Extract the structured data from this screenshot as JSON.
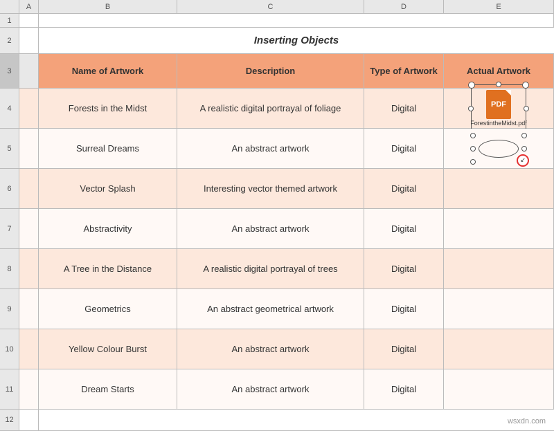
{
  "title": "Inserting Objects",
  "colHeaders": [
    "",
    "A",
    "B",
    "C",
    "D",
    "E"
  ],
  "tableHeaders": {
    "name": "Name of Artwork",
    "description": "Description",
    "type": "Type of Artwork",
    "actual": "Actual Artwork"
  },
  "rows": [
    {
      "rowNum": "4",
      "name": "Forests in the Midst",
      "description": "A realistic digital portrayal of  foliage",
      "type": "Digital",
      "hasObject": "pdf"
    },
    {
      "rowNum": "5",
      "name": "Surreal Dreams",
      "description": "An abstract artwork",
      "type": "Digital",
      "hasObject": "ellipse"
    },
    {
      "rowNum": "6",
      "name": "Vector Splash",
      "description": "Interesting vector themed artwork",
      "type": "Digital",
      "hasObject": ""
    },
    {
      "rowNum": "7",
      "name": "Abstractivity",
      "description": "An abstract artwork",
      "type": "Digital",
      "hasObject": ""
    },
    {
      "rowNum": "8",
      "name": "A Tree in the Distance",
      "description": "A realistic digital portrayal of trees",
      "type": "Digital",
      "hasObject": ""
    },
    {
      "rowNum": "9",
      "name": "Geometrics",
      "description": "An abstract geometrical artwork",
      "type": "Digital",
      "hasObject": ""
    },
    {
      "rowNum": "10",
      "name": "Yellow Colour Burst",
      "description": "An abstract artwork",
      "type": "Digital",
      "hasObject": ""
    },
    {
      "rowNum": "11",
      "name": "Dream Starts",
      "description": "An abstract artwork",
      "type": "Digital",
      "hasObject": ""
    }
  ],
  "pdfFilename": "ForestintheMidst.pdf",
  "watermark": "wsxdn.com"
}
